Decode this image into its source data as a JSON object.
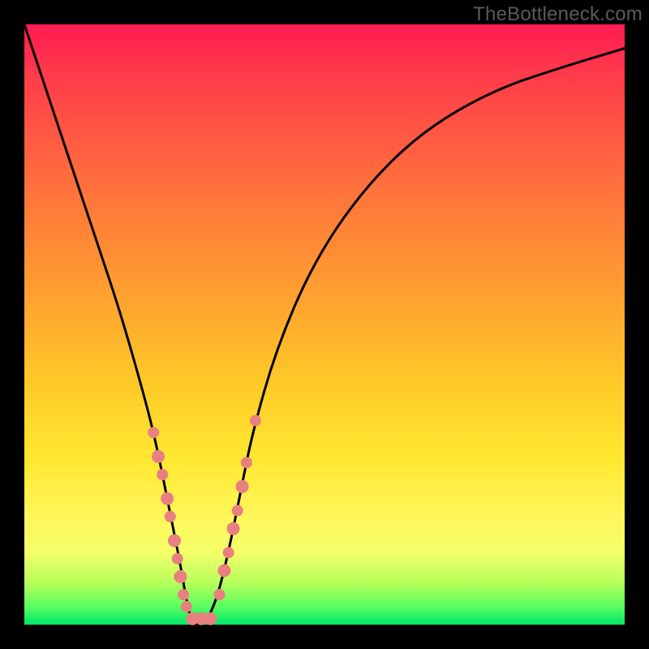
{
  "watermark": "TheBottleneck.com",
  "chart_data": {
    "type": "line",
    "title": "",
    "xlabel": "",
    "ylabel": "",
    "xlim": [
      0,
      100
    ],
    "ylim": [
      0,
      100
    ],
    "series": [
      {
        "name": "bottleneck-curve",
        "x": [
          0,
          4,
          8,
          12,
          16,
          20,
          22,
          24,
          26,
          27,
          28,
          30,
          32,
          34,
          36,
          38,
          42,
          48,
          56,
          66,
          78,
          90,
          100
        ],
        "values": [
          100,
          88,
          76,
          64,
          52,
          38,
          30,
          20,
          10,
          4,
          0,
          0,
          4,
          12,
          22,
          32,
          46,
          60,
          72,
          82,
          89,
          93,
          96
        ]
      }
    ],
    "markers": {
      "name": "highlighted-points",
      "color": "#e98080",
      "points": [
        {
          "x": 21.5,
          "y": 32,
          "r": 7
        },
        {
          "x": 22.3,
          "y": 28,
          "r": 8
        },
        {
          "x": 23.0,
          "y": 25,
          "r": 7
        },
        {
          "x": 23.8,
          "y": 21,
          "r": 8
        },
        {
          "x": 24.3,
          "y": 18,
          "r": 7
        },
        {
          "x": 25.0,
          "y": 14,
          "r": 8
        },
        {
          "x": 25.5,
          "y": 11,
          "r": 7
        },
        {
          "x": 26.0,
          "y": 8,
          "r": 8
        },
        {
          "x": 26.5,
          "y": 5,
          "r": 7
        },
        {
          "x": 27.0,
          "y": 3,
          "r": 7
        },
        {
          "x": 28.0,
          "y": 1,
          "r": 8
        },
        {
          "x": 29.5,
          "y": 1,
          "r": 8
        },
        {
          "x": 31.0,
          "y": 1,
          "r": 8
        },
        {
          "x": 32.5,
          "y": 5,
          "r": 7
        },
        {
          "x": 33.3,
          "y": 9,
          "r": 8
        },
        {
          "x": 34.0,
          "y": 12,
          "r": 7
        },
        {
          "x": 34.8,
          "y": 16,
          "r": 8
        },
        {
          "x": 35.5,
          "y": 19,
          "r": 7
        },
        {
          "x": 36.3,
          "y": 23,
          "r": 8
        },
        {
          "x": 37.0,
          "y": 27,
          "r": 7
        },
        {
          "x": 38.5,
          "y": 34,
          "r": 7
        }
      ]
    }
  }
}
